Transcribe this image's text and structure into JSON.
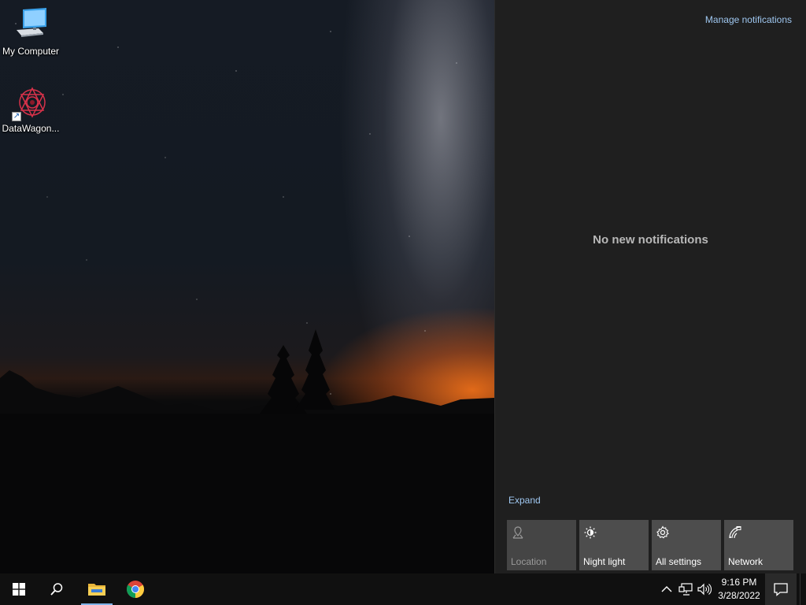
{
  "desktop": {
    "icons": [
      {
        "label": "My Computer",
        "icon": "computer-icon"
      },
      {
        "label": "DataWagon...",
        "icon": "datawagon-icon"
      }
    ]
  },
  "action_center": {
    "manage_label": "Manage notifications",
    "empty_label": "No new notifications",
    "expand_label": "Expand",
    "quick_actions": [
      {
        "label": "Location",
        "icon": "location-icon",
        "enabled": false
      },
      {
        "label": "Night light",
        "icon": "night-light-icon",
        "enabled": true
      },
      {
        "label": "All settings",
        "icon": "gear-icon",
        "enabled": true
      },
      {
        "label": "Network",
        "icon": "network-icon",
        "enabled": true
      }
    ]
  },
  "taskbar": {
    "pinned": [
      {
        "name": "start",
        "icon": "windows-logo-icon"
      },
      {
        "name": "search",
        "icon": "search-icon"
      },
      {
        "name": "file-explorer",
        "icon": "folder-icon",
        "active": true
      },
      {
        "name": "chrome",
        "icon": "chrome-icon"
      }
    ],
    "tray": {
      "time": "9:16 PM",
      "date": "3/28/2022"
    }
  },
  "colors": {
    "accent": "#9fc7f0",
    "panel_bg": "#1f1f1f",
    "tile_bg": "#4d4d4d",
    "taskbar_bg": "#101010"
  }
}
